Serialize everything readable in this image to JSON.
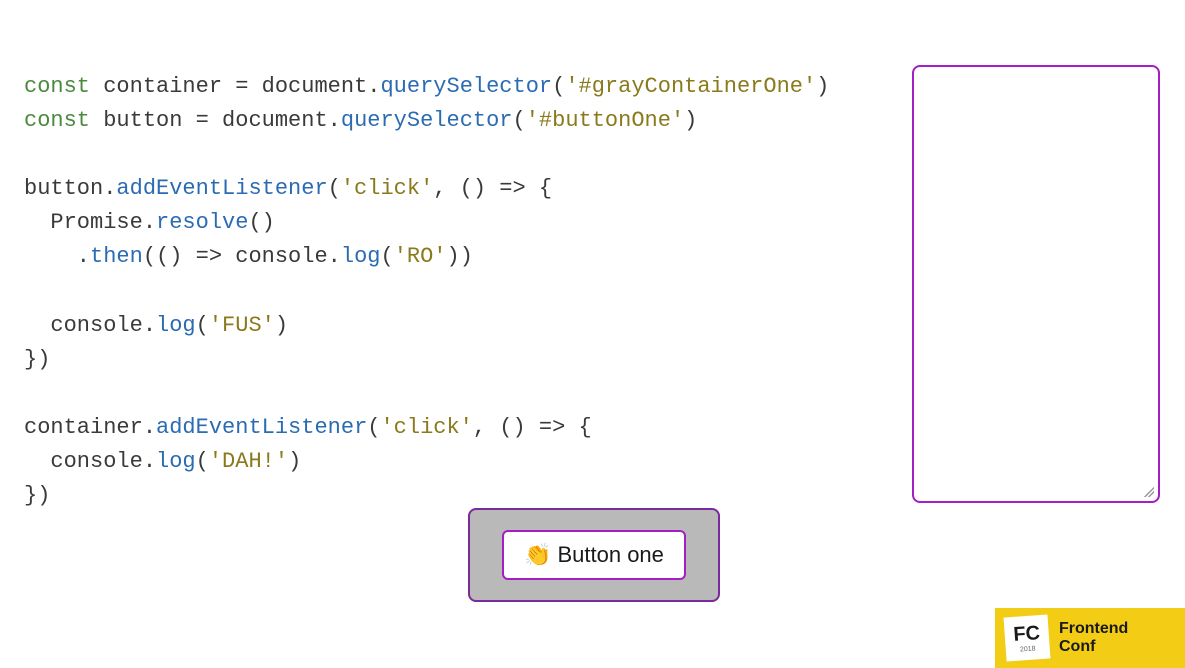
{
  "code": {
    "line1_kw": "const",
    "line1_var": " container ",
    "line1_eq": "=",
    "line1_doc": " document.",
    "line1_method": "querySelector",
    "line1_open": "(",
    "line1_str": "'#grayContainerOne'",
    "line1_close": ")",
    "line2_kw": "const",
    "line2_var": " button ",
    "line2_eq": "=",
    "line2_doc": " document.",
    "line2_method": "querySelector",
    "line2_open": "(",
    "line2_str": "'#buttonOne'",
    "line2_close": ")",
    "line4_obj": "button.",
    "line4_method": "addEventListener",
    "line4_open": "(",
    "line4_str": "'click'",
    "line4_comma": ", () ",
    "line4_arrow": "=>",
    "line4_curly": " {",
    "line5_obj": "  Promise.",
    "line5_method": "resolve",
    "line5_paren": "()",
    "line6_dot": "    .",
    "line6_method": "then",
    "line6_open": "(() ",
    "line6_arrow": "=>",
    "line6_cons": " console.",
    "line6_log": "log",
    "line6_po": "(",
    "line6_str": "'RO'",
    "line6_pc": "))",
    "line8_obj": "  console.",
    "line8_method": "log",
    "line8_open": "(",
    "line8_str": "'FUS'",
    "line8_close": ")",
    "line9_close": "})",
    "line11_obj": "container.",
    "line11_method": "addEventListener",
    "line11_open": "(",
    "line11_str": "'click'",
    "line11_comma": ", () ",
    "line11_arrow": "=>",
    "line11_curly": " {",
    "line12_obj": "  console.",
    "line12_method": "log",
    "line12_open": "(",
    "line12_str": "'DAH!'",
    "line12_close": ")",
    "line13_close": "})"
  },
  "button": {
    "icon": "👏",
    "label": "Button one"
  },
  "logo": {
    "fc": "FC",
    "year": "2018",
    "line1": "Frontend",
    "line2": "Conf"
  }
}
